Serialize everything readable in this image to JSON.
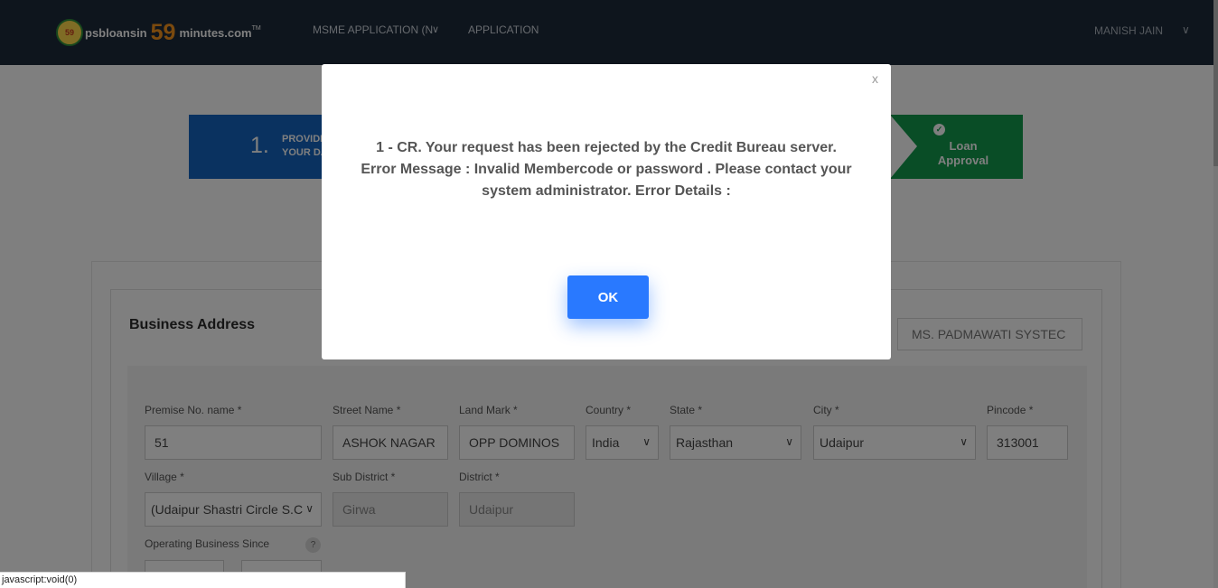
{
  "header": {
    "logo_text_1": "psbloansin",
    "logo_text_59": "59",
    "logo_text_2": "minutes.com",
    "logo_tm": "TM",
    "logo_badge": "59",
    "nav_msme": "MSME APPLICATION (N",
    "nav_application": "APPLICATION",
    "user_name": "MANISH JAIN"
  },
  "stepper": {
    "step1_number": "1.",
    "step1_label_line1": "PROVIDE",
    "step1_label_line2": "YOUR DA",
    "step5_label": "Loan Approval"
  },
  "form": {
    "section_title": "Business Address",
    "business_name": "MS. PADMAWATI SYSTEC",
    "fields": {
      "premise": {
        "label": "Premise No. name *",
        "value": "51"
      },
      "street": {
        "label": "Street Name *",
        "value": "ASHOK NAGAR"
      },
      "landmark": {
        "label": "Land Mark *",
        "value": "OPP DOMINOS"
      },
      "country": {
        "label": "Country *",
        "value": "India"
      },
      "state": {
        "label": "State *",
        "value": "Rajasthan"
      },
      "city": {
        "label": "City *",
        "value": "Udaipur"
      },
      "pincode": {
        "label": "Pincode *",
        "value": "313001"
      },
      "village": {
        "label": "Village *",
        "value": "(Udaipur Shastri Circle S.C"
      },
      "sub_district": {
        "label": "Sub District *",
        "value": "Girwa"
      },
      "district": {
        "label": "District *",
        "value": "Udaipur"
      },
      "operating_since": {
        "label": "Operating Business Since"
      }
    },
    "help_glyph": "?"
  },
  "modal": {
    "close_glyph": "x",
    "message": "1 - CR. Your request has been rejected by the Credit Bureau server. Error Message : Invalid Membercode or password . Please contact your system administrator. Error Details :",
    "ok_label": "OK"
  },
  "statusbar": {
    "text": "javascript:void(0)"
  },
  "colors": {
    "nav_bg": "#1d2a3a",
    "step1": "#1565c0",
    "step5": "#129a4c",
    "ok_button": "#2979ff"
  },
  "icons": {
    "nav_dropdown": "chevron-down-icon",
    "user_dropdown": "chevron-down-icon",
    "step_complete": "check-circle-icon",
    "select_dropdown": "chevron-down-icon",
    "help": "question-icon"
  }
}
